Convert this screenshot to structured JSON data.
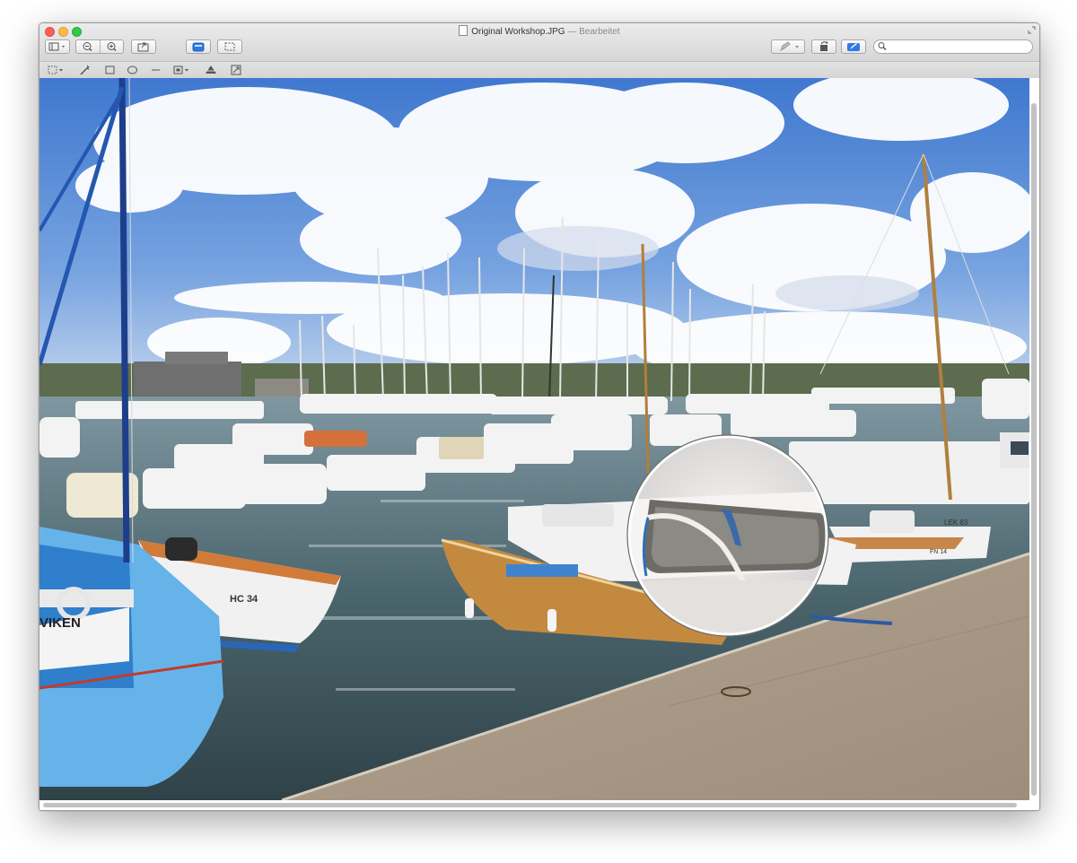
{
  "window": {
    "title": "Original Workshop.JPG",
    "separator": "—",
    "state": "Bearbeitet"
  },
  "toolbar": {
    "sidebar_icon": "sidebar-toggle-icon",
    "zoom_out_icon": "zoom-out-icon",
    "zoom_in_icon": "zoom-in-icon",
    "share_icon": "share-icon",
    "markup_icon": "markup-toolbox-icon",
    "selection_icon": "selection-icon",
    "edit_icon": "pencil-icon",
    "rotate_icon": "rotate-icon",
    "annotate_icon": "annotate-icon"
  },
  "search": {
    "placeholder": "",
    "value": ""
  },
  "markup_tools": [
    {
      "name": "rect-selection-tool",
      "icon": "dashed-rect-icon"
    },
    {
      "name": "instant-alpha-tool",
      "icon": "magic-wand-icon"
    },
    {
      "name": "rectangle-tool",
      "icon": "rectangle-icon"
    },
    {
      "name": "oval-tool",
      "icon": "oval-icon"
    },
    {
      "name": "line-tool",
      "icon": "line-icon"
    },
    {
      "name": "shape-tool",
      "icon": "shape-icon"
    },
    {
      "name": "adjust-color-tool",
      "icon": "triangle-stack-icon"
    },
    {
      "name": "adjust-size-tool",
      "icon": "resize-icon"
    }
  ],
  "colors": {
    "sky": "#4f86d6",
    "water": "#3f5a63",
    "pier": "#a59684",
    "blue_boat": "#4fa5e0",
    "wood_boat": "#c58a3c"
  },
  "boat_labels": {
    "blue_boat_name": "VIKEN",
    "dinghy_reg": "HC 34",
    "right_boat_reg": "LEK 83",
    "right_boat_reg2": "FN 14"
  }
}
